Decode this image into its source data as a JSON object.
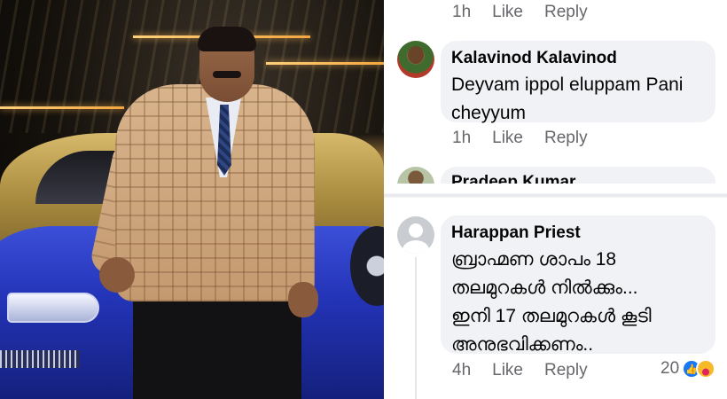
{
  "comments": [
    {
      "time": "1h",
      "like_label": "Like",
      "reply_label": "Reply"
    },
    {
      "author": "Kalavinod Kalavinod",
      "text_lines": [
        "Deyvam ippol eluppam Pani",
        "cheyyum"
      ],
      "time": "1h",
      "like_label": "Like",
      "reply_label": "Reply"
    },
    {
      "author": "Pradeep Kumar"
    },
    {
      "author": "Harappan Priest",
      "text_lines": [
        "ബ്രാഹ്മണ ശാപം 18",
        "തലമുറകൾ നിൽക്കും...",
        "ഇനി 17 തലമുറകൾ കൂടി",
        "അനുഭവിക്കണം.."
      ],
      "time": "4h",
      "like_label": "Like",
      "reply_label": "Reply",
      "reaction_count": "20",
      "reaction_icons": [
        "like-icon",
        "haha-icon"
      ]
    }
  ],
  "colors": {
    "bubble": "#f0f2f5",
    "meta_text": "#65676b",
    "like_blue": "#1877f2"
  }
}
